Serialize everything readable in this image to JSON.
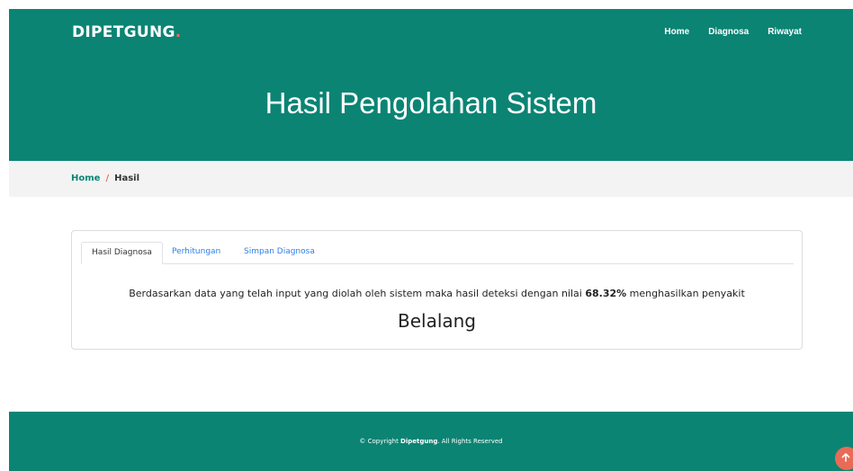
{
  "brand": {
    "name": "DIPETGUNG",
    "dot": "."
  },
  "nav": {
    "home": "Home",
    "diagnosa": "Diagnosa",
    "riwayat": "Riwayat"
  },
  "hero": {
    "title": "Hasil Pengolahan Sistem"
  },
  "breadcrumb": {
    "home": "Home",
    "separator": "/",
    "current": "Hasil"
  },
  "tabs": [
    {
      "label": "Hasil Diagnosa",
      "active": true
    },
    {
      "label": "Perhitungan",
      "active": false
    },
    {
      "label": "Simpan Diagnosa",
      "active": false
    }
  ],
  "result": {
    "text_before": "Berdasarkan data yang telah input yang diolah oleh sistem maka hasil deteksi dengan nilai ",
    "value": "68.32%",
    "text_after": " menghasilkan penyakit",
    "disease": "Belalang"
  },
  "footer": {
    "prefix": "© Copyright ",
    "brand": "Dipetgung",
    "suffix": ". All Rights Reserved"
  },
  "colors": {
    "primary": "#0b8474",
    "accent": "#e96b56",
    "link": "#2f7fe6",
    "crumb_bg": "#f3f3f3"
  },
  "icons": {
    "back_to_top": "arrow-up-icon"
  }
}
